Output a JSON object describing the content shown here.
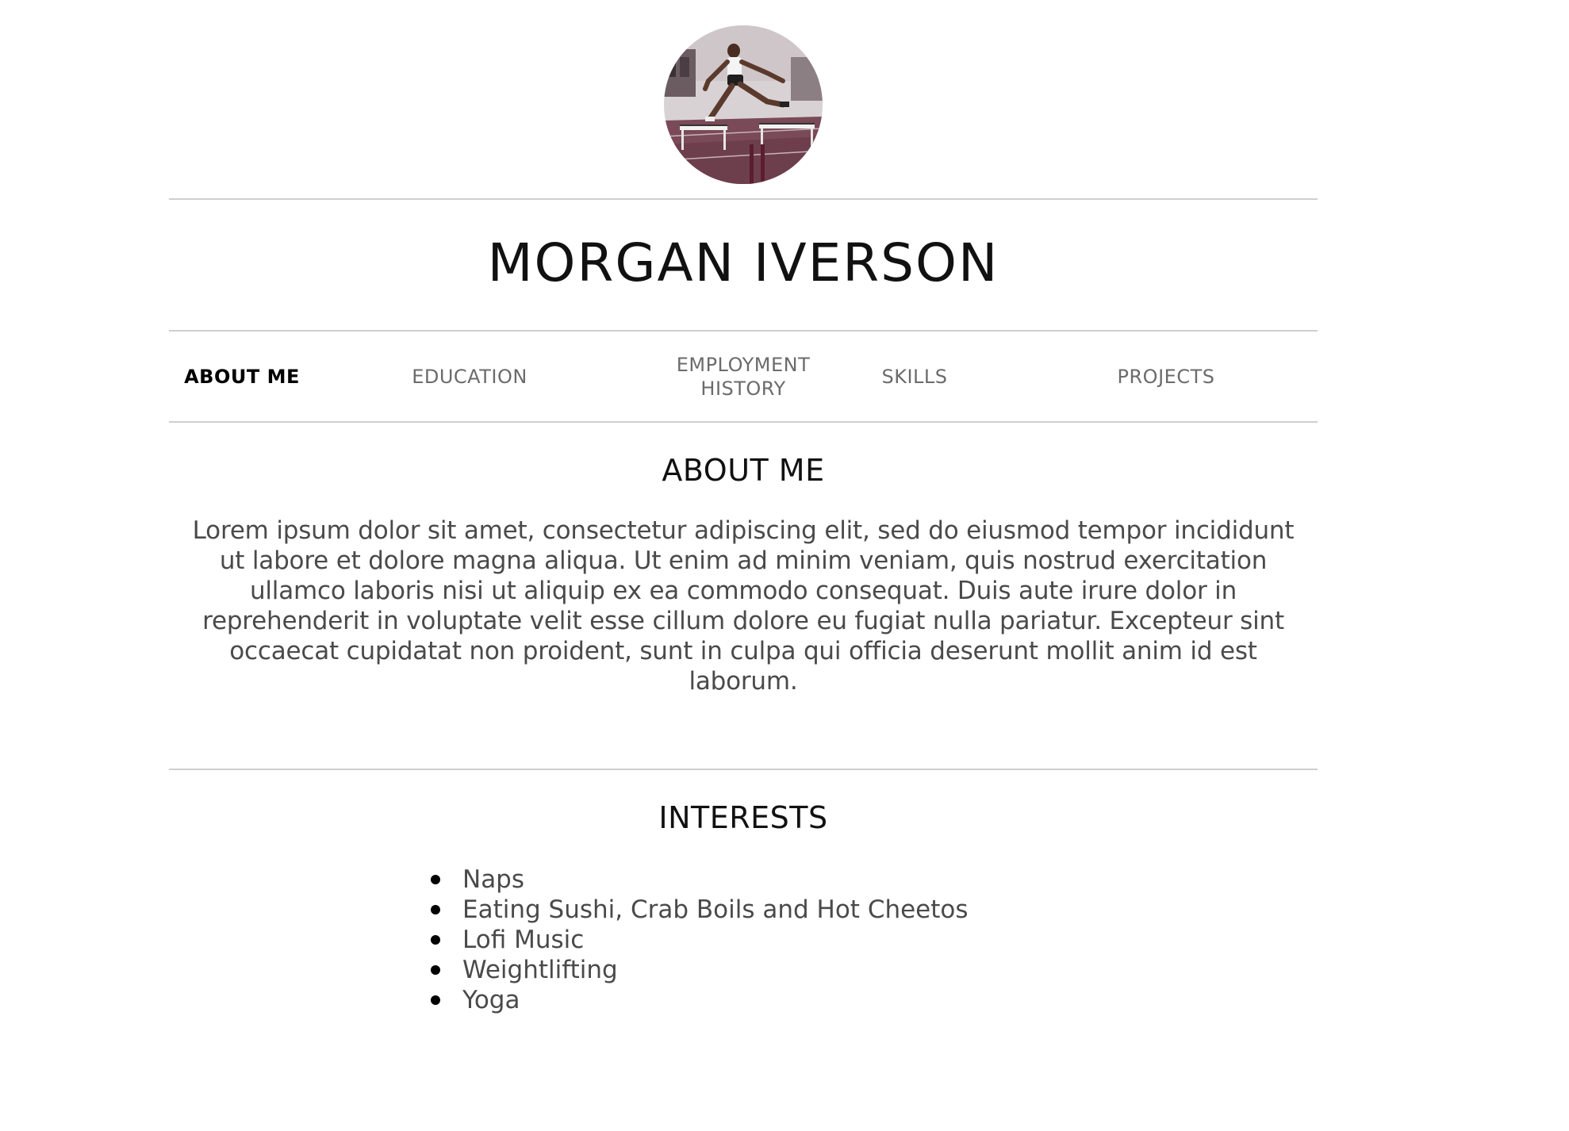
{
  "header": {
    "avatar_alt": "Hurdler clearing a hurdle on an indoor track",
    "name": "MORGAN IVERSON"
  },
  "nav": {
    "items": [
      {
        "label": "ABOUT ME",
        "active": true
      },
      {
        "label": "EDUCATION",
        "active": false
      },
      {
        "label": "EMPLOYMENT HISTORY",
        "active": false
      },
      {
        "label": "SKILLS",
        "active": false
      },
      {
        "label": "PROJECTS",
        "active": false
      }
    ]
  },
  "about": {
    "title": "ABOUT ME",
    "text": "Lorem ipsum dolor sit amet, consectetur adipiscing elit, sed do eiusmod tempor incididunt ut labore et dolore magna aliqua. Ut enim ad minim veniam, quis nostrud exercitation ullamco laboris nisi ut aliquip ex ea commodo consequat. Duis aute irure dolor in reprehenderit in voluptate velit esse cillum dolore eu fugiat nulla pariatur. Excepteur sint occaecat cupidatat non proident, sunt in culpa qui officia deserunt mollit anim id est laborum."
  },
  "interests": {
    "title": "INTERESTS",
    "items": [
      "Naps",
      "Eating Sushi, Crab Boils and Hot Cheetos",
      "Lofi Music",
      "Weightlifting",
      "Yoga"
    ]
  },
  "colors": {
    "text": "#111111",
    "muted": "#6b6b6b",
    "rule": "#cfcfcf",
    "track": "#7a4a58"
  }
}
